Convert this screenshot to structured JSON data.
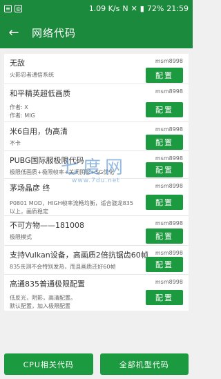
{
  "status": {
    "speed": "1.09 K/s",
    "battery": "72%",
    "time": "21:59"
  },
  "appbar": {
    "back_icon": "←",
    "title": "网络代码"
  },
  "items": [
    {
      "title": "无敌",
      "author": "msm8998",
      "desc": [
        "火影忍者通信系统"
      ],
      "button": "配置"
    },
    {
      "title": "和平精英超低画质",
      "author": "msm8998",
      "desc": [
        "作者: X",
        "作者: MIG"
      ],
      "button": "配置"
    },
    {
      "title": "米6自用，伪高清",
      "author": "msm8998",
      "desc": [
        "不卡"
      ],
      "button": "配置"
    },
    {
      "title": "PUBG国际服极限代码",
      "author": "msm8998",
      "desc": [
        "极限低画质+极限帧率+关闭阴影+SG优化"
      ],
      "button": "配置"
    },
    {
      "title": "茅场晶彦 终",
      "author": "msm8998",
      "desc": [
        "P0801 MOD，HIGH帧率流畅均衡，适合骁龙835",
        "以上，画质稳定"
      ],
      "button": "配置"
    },
    {
      "title": "不可方物——181008",
      "author": "msm8998",
      "desc": [
        "极限模式"
      ],
      "button": "配置"
    },
    {
      "title": "支持Vulkan设备，高画质2倍抗锯齿60帧",
      "author": "msm8998",
      "desc": [
        "835亲测不会特别发热，而且画质还好60帧"
      ],
      "button": "配置"
    },
    {
      "title": "高通835普通极限配置",
      "author": "msm8998",
      "desc": [
        "低反光，阴影，高清配置。",
        "默认配置，加入极限配置"
      ],
      "button": "配置"
    }
  ],
  "bottom": {
    "cpu_label": "CPU相关代码",
    "all_label": "全部机型代码"
  },
  "watermark": {
    "main": "七度网",
    "sub": "www.7du.net"
  }
}
